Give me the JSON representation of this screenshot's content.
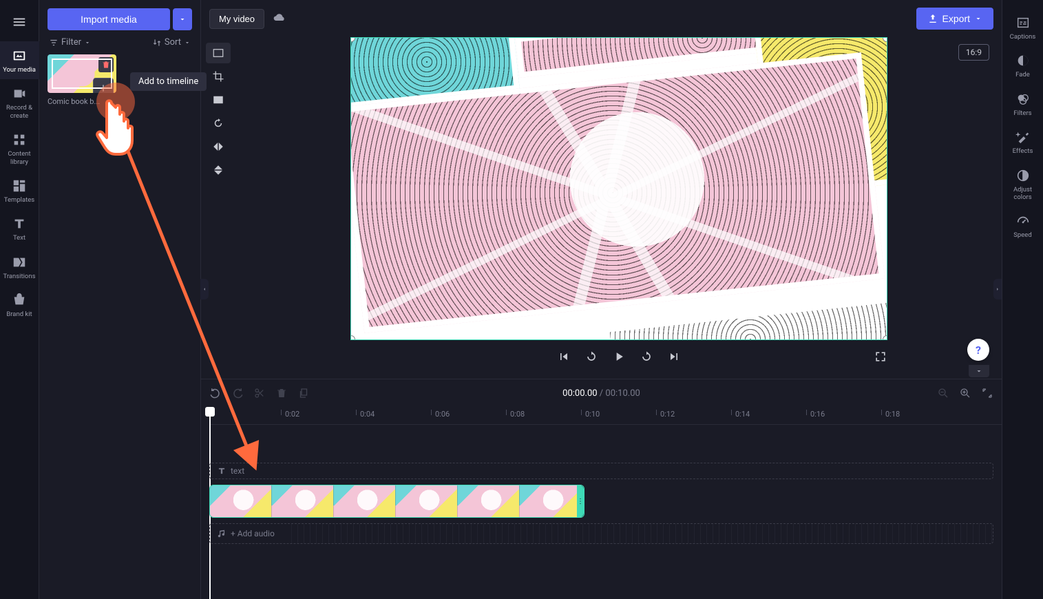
{
  "header": {
    "import_label": "Import media",
    "title_value": "My video",
    "export_label": "Export",
    "aspect_ratio": "16:9"
  },
  "panel": {
    "filter_label": "Filter",
    "sort_label": "Sort",
    "media_item_name": "Comic book b...",
    "add_tooltip": "Add to timeline"
  },
  "left_rail": {
    "items": [
      {
        "label": "Your media",
        "icon": "media"
      },
      {
        "label": "Record & create",
        "icon": "record"
      },
      {
        "label": "Content library",
        "icon": "library"
      },
      {
        "label": "Templates",
        "icon": "templates"
      },
      {
        "label": "Text",
        "icon": "text"
      },
      {
        "label": "Transitions",
        "icon": "transitions"
      },
      {
        "label": "Brand kit",
        "icon": "brand"
      }
    ]
  },
  "right_rail": {
    "items": [
      {
        "label": "Captions",
        "icon": "captions"
      },
      {
        "label": "Fade",
        "icon": "fade"
      },
      {
        "label": "Filters",
        "icon": "filters"
      },
      {
        "label": "Effects",
        "icon": "effects"
      },
      {
        "label": "Adjust colors",
        "icon": "adjust"
      },
      {
        "label": "Speed",
        "icon": "speed"
      }
    ]
  },
  "timeline": {
    "current": "00:00.00",
    "separator": " / ",
    "total": "00:10.00",
    "ruler_start": "0",
    "ruler_marks": [
      {
        "label": "0:02",
        "pos": 110
      },
      {
        "label": "0:04",
        "pos": 219
      },
      {
        "label": "0:06",
        "pos": 328
      },
      {
        "label": "0:08",
        "pos": 437
      },
      {
        "label": "0:10",
        "pos": 546
      },
      {
        "label": "0:12",
        "pos": 655
      },
      {
        "label": "0:14",
        "pos": 764
      },
      {
        "label": "0:16",
        "pos": 873
      },
      {
        "label": "0:18",
        "pos": 982
      }
    ],
    "text_track_label": "text",
    "audio_track_label": "+ Add audio"
  },
  "help": "?"
}
